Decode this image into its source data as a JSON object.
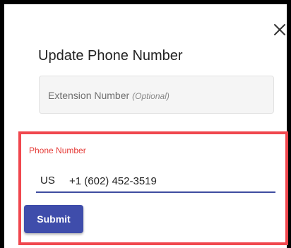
{
  "dialog": {
    "title": "Update Phone Number",
    "close_icon": "close-icon"
  },
  "extension": {
    "placeholder": "Extension Number",
    "optional_hint": "(Optional)"
  },
  "phone": {
    "label": "Phone Number",
    "country_code": "US",
    "value": "+1 (602) 452-3519"
  },
  "actions": {
    "submit_label": "Submit"
  },
  "colors": {
    "accent": "#3f4dab",
    "error": "#e53935",
    "highlight": "#f0474e"
  }
}
